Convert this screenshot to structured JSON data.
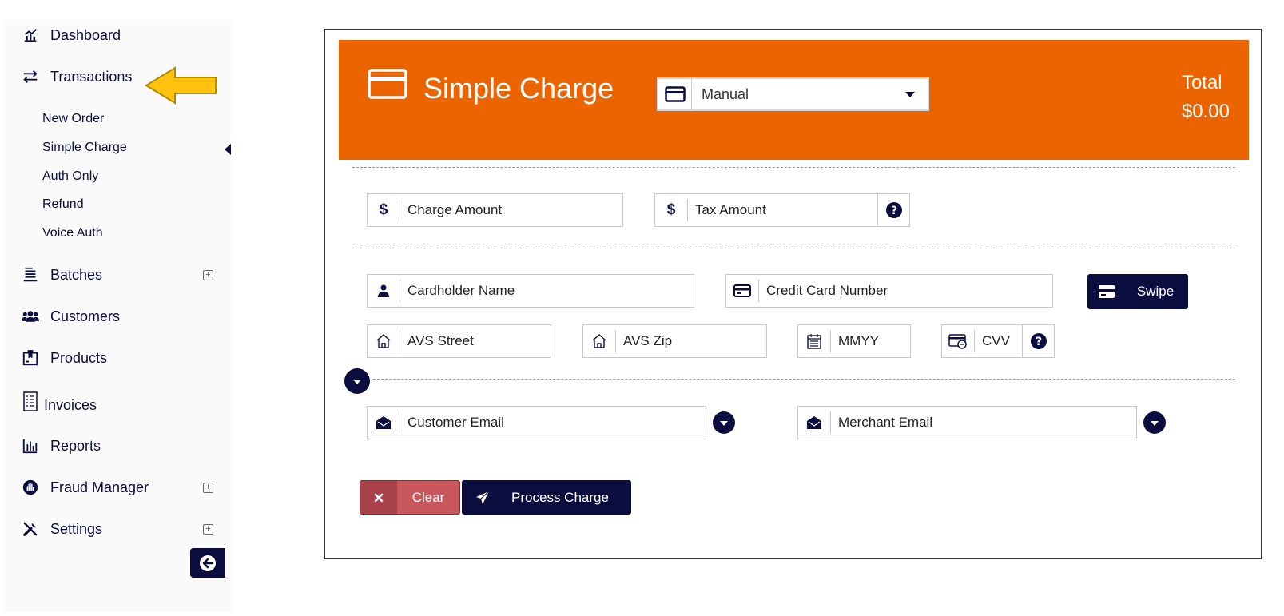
{
  "sidebar": {
    "items": {
      "dashboard": "Dashboard",
      "transactions": "Transactions",
      "batches": "Batches",
      "customers": "Customers",
      "products": "Products",
      "invoices": "Invoices",
      "reports": "Reports",
      "fraud": "Fraud Manager",
      "settings": "Settings"
    },
    "sub_items": {
      "new_order": "New Order",
      "simple_charge": "Simple Charge",
      "auth_only": "Auth Only",
      "refund": "Refund",
      "voice_auth": "Voice Auth"
    },
    "active_sub_item": "simple_charge",
    "icons": [
      "chart-line-icon",
      "exchange-icon",
      "list-icon",
      "users-icon",
      "box-icon",
      "document-icon",
      "bar-chart-icon",
      "hand-shield-icon",
      "tools-icon",
      "back-arrow-icon"
    ]
  },
  "header": {
    "title": "Simple Charge",
    "entry_mode": "Manual",
    "total_label": "Total",
    "total_value": "$0.00",
    "color": "#ec6400"
  },
  "form": {
    "charge_amount": "Charge Amount",
    "tax_amount": "Tax Amount",
    "cardholder_name": "Cardholder Name",
    "credit_card_number": "Credit Card Number",
    "swipe": "Swipe",
    "avs_street": "AVS Street",
    "avs_zip": "AVS Zip",
    "mmyy": "MMYY",
    "cvv": "CVV",
    "customer_email": "Customer Email",
    "merchant_email": "Merchant Email"
  },
  "actions": {
    "clear": "Clear",
    "process": "Process Charge"
  },
  "colors": {
    "navy": "#0b0d3f",
    "orange": "#ec6400",
    "clear_red": "#c9575c",
    "callout_yellow": "#ffc20e"
  }
}
